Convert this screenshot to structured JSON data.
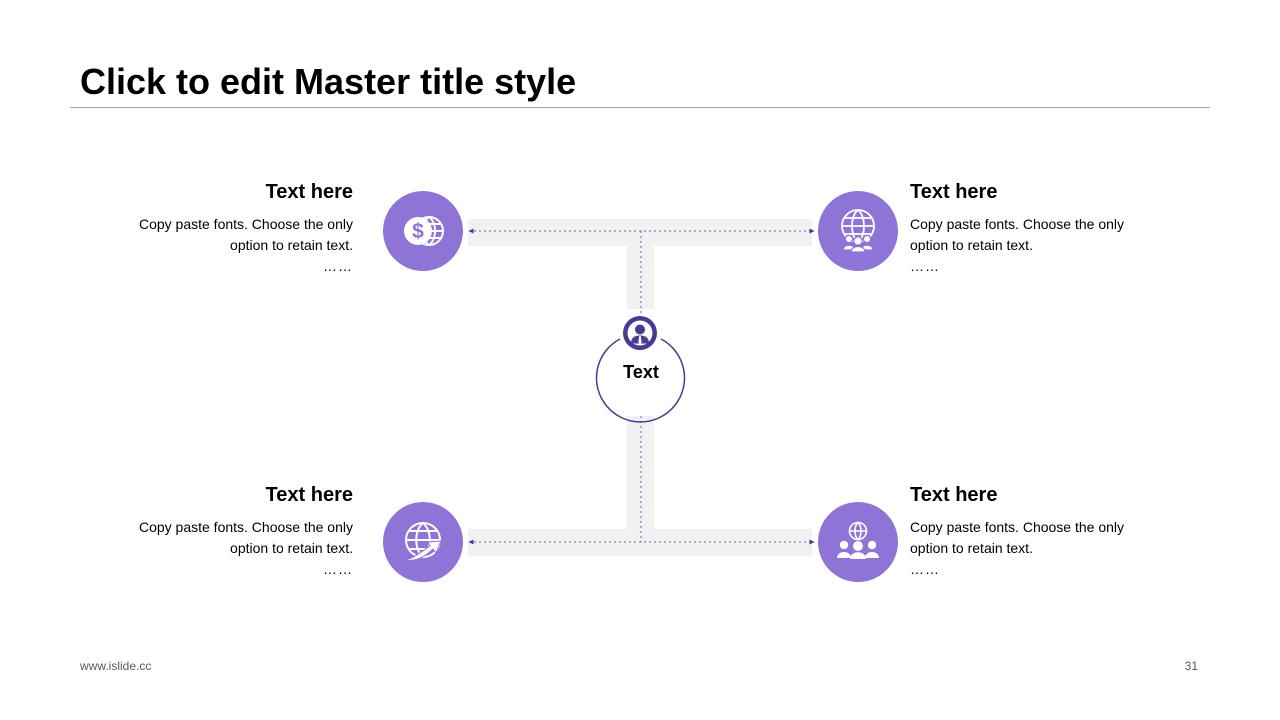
{
  "slide": {
    "title": "Click to edit Master title style"
  },
  "center": {
    "label": "Text",
    "icon": "person-icon"
  },
  "blocks": [
    {
      "title": "Text here",
      "body": "Copy paste fonts. Choose the only option to retain text.",
      "ellipsis": "……",
      "icon": "dollar-globe-icon"
    },
    {
      "title": "Text here",
      "body": "Copy paste fonts. Choose the only option to retain text.",
      "ellipsis": "……",
      "icon": "globe-people-icon"
    },
    {
      "title": "Text here",
      "body": "Copy paste fonts. Choose the only option to retain text.",
      "ellipsis": "……",
      "icon": "globe-arrow-icon"
    },
    {
      "title": "Text here",
      "body": "Copy paste fonts. Choose the only option to retain text.",
      "ellipsis": "……",
      "icon": "team-globe-icon"
    }
  ],
  "footer": {
    "url": "www.islide.cc",
    "page": "31"
  },
  "colors": {
    "accent": "#8e74d6",
    "dark_accent": "#4b3a8f",
    "track": "#f1f1f1",
    "rule": "#a6a6a6"
  }
}
